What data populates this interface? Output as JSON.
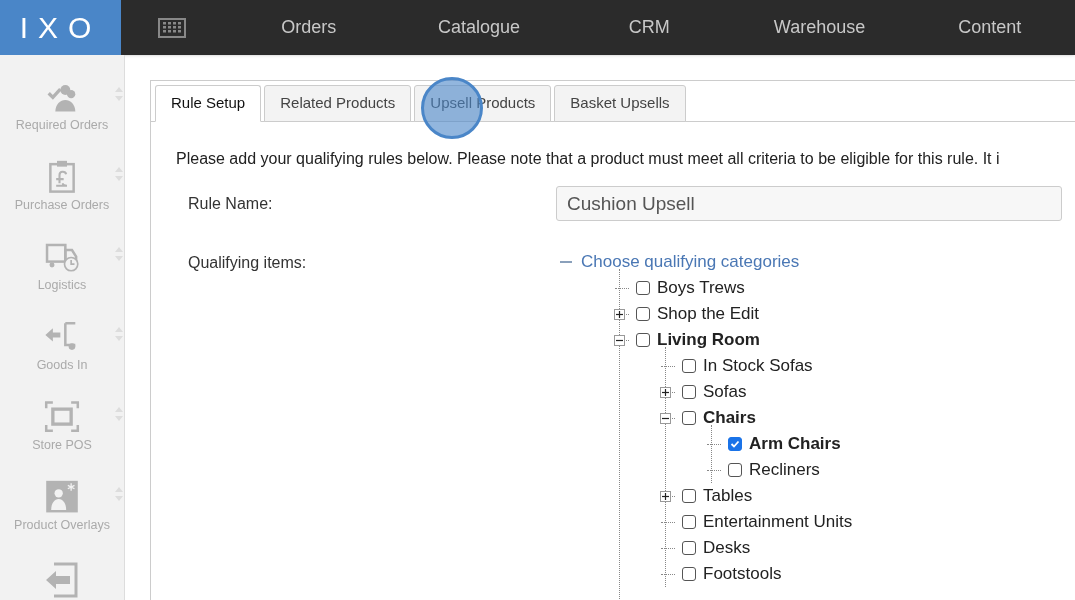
{
  "logo": "IXO",
  "nav": [
    {
      "label": "Orders"
    },
    {
      "label": "Catalogue"
    },
    {
      "label": "CRM"
    },
    {
      "label": "Warehouse"
    },
    {
      "label": "Content"
    }
  ],
  "sidebar": {
    "items": [
      {
        "kind": "required",
        "label": "Required Orders"
      },
      {
        "kind": "purchase",
        "label": "Purchase Orders"
      },
      {
        "kind": "logistics",
        "label": "Logistics"
      },
      {
        "kind": "goods",
        "label": "Goods In"
      },
      {
        "kind": "pos",
        "label": "Store POS"
      },
      {
        "kind": "overlay",
        "label": "Product Overlays"
      },
      {
        "kind": "exit"
      }
    ]
  },
  "tabs": [
    {
      "label": "Rule Setup",
      "selected": true
    },
    {
      "label": "Related Products",
      "selected": false
    },
    {
      "label": "Upsell Products",
      "selected": false
    },
    {
      "label": "Basket Upsells",
      "selected": false
    }
  ],
  "intro": "Please add your qualifying rules below. Please note that a product must meet all criteria to be eligible for this rule. It i",
  "rule_name": {
    "label": "Rule Name:",
    "value": "Cushion Upsell"
  },
  "qualifying": {
    "label": "Qualifying items:",
    "root": "Choose qualifying categories",
    "tree": [
      {
        "label": "Boys Trews",
        "kind": "leaf",
        "checked": false
      },
      {
        "label": "Shop the Edit",
        "kind": "branch",
        "expanded": false,
        "checked": false
      },
      {
        "label": "Living Room",
        "kind": "branch",
        "expanded": true,
        "checked": false,
        "children": [
          {
            "label": "In Stock Sofas",
            "kind": "leaf",
            "checked": false
          },
          {
            "label": "Sofas",
            "kind": "branch",
            "expanded": false,
            "checked": false
          },
          {
            "label": "Chairs",
            "kind": "branch",
            "expanded": true,
            "checked": false,
            "children": [
              {
                "label": "Arm Chairs",
                "kind": "leaf",
                "checked": true
              },
              {
                "label": "Recliners",
                "kind": "leaf",
                "checked": false
              }
            ]
          },
          {
            "label": "Tables",
            "kind": "branch",
            "expanded": false,
            "checked": false
          },
          {
            "label": "Entertainment Units",
            "kind": "leaf",
            "checked": false
          },
          {
            "label": "Desks",
            "kind": "leaf",
            "checked": false
          },
          {
            "label": "Footstools",
            "kind": "leaf",
            "checked": false
          }
        ]
      }
    ]
  }
}
